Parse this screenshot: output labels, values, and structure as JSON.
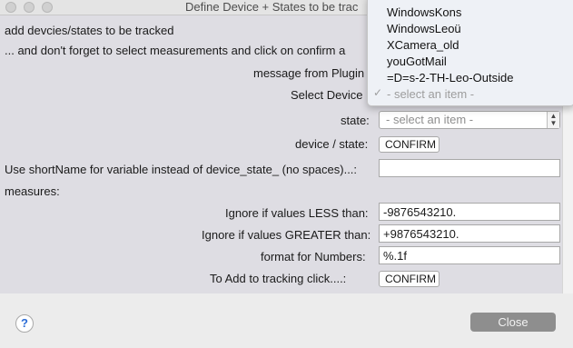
{
  "window": {
    "title": "Define Device + States to be trac"
  },
  "intro": {
    "line1": "add devcies/states to be tracked",
    "line2": " ... and don't forget to select measurements and click on confirm a",
    "message": "message from Plugin"
  },
  "form": {
    "select_device_label": "Select  Device",
    "state_label": "state:",
    "state_placeholder": "- select an item -",
    "device_state_label": "device / state:",
    "confirm_label": "CONFIRM",
    "shortname_label": "Use shortName for variable instead of device_state_ (no spaces)...:",
    "shortname_value": "",
    "measures_label": "measures:",
    "ignore_less_label": "Ignore if values LESS than:",
    "ignore_less_value": "-9876543210.",
    "ignore_greater_label": "Ignore if values GREATER than:",
    "ignore_greater_value": "+9876543210.",
    "format_label": "format for Numbers:",
    "format_value": "%.1f",
    "to_add_label": "To Add  to tracking    click....:",
    "confirm2_label": "CONFIRM"
  },
  "device_popup": {
    "items": [
      "WindowsKons",
      "WindowsLeoü",
      "XCamera_old",
      "youGotMail",
      "=D=s-2-TH-Leo-Outside"
    ],
    "selected": "- select an item -"
  },
  "footer": {
    "help_label": "?",
    "close_label": "Close"
  },
  "colors": {
    "content_bg": "#dedde3",
    "close_button": "#8e8e8e",
    "help_accent": "#2b6cd6"
  }
}
